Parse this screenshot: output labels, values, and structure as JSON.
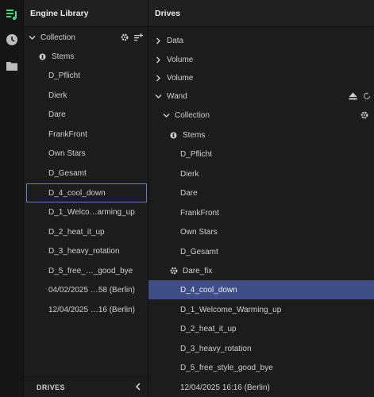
{
  "colors": {
    "accent_green": "#3ddc84",
    "selection_blue": "#3f4d85",
    "outline_blue": "#6b7bbd"
  },
  "rail": {
    "icons": [
      "playlist-icon",
      "history-clock-icon",
      "folder-icon"
    ]
  },
  "left": {
    "title": "Engine Library",
    "collection_label": "Collection",
    "stems_label": "Stems",
    "items": [
      "D_Pflicht",
      "Dierk",
      "Dare",
      "FrankFront",
      "Own Stars",
      "D_Gesamt",
      "D_4_cool_down",
      "D_1_Welco…arming_up",
      "D_2_heat_it_up",
      "D_3_heavy_rotation",
      "D_5_free_…_good_bye",
      "04/02/2025 …58 (Berlin)",
      "12/04/2025 …16 (Berlin)"
    ],
    "footer_label": "DRIVES"
  },
  "right": {
    "title": "Drives",
    "drives": [
      "Data",
      "Volume",
      "Volume",
      "Wand"
    ],
    "collection_label": "Collection",
    "stems_label": "Stems",
    "items": [
      "D_Pflicht",
      "Dierk",
      "Dare",
      "FrankFront",
      "Own Stars",
      "D_Gesamt"
    ],
    "dare_fix_label": "Dare_fix",
    "items2": [
      "D_4_cool_down",
      "D_1_Welcome_Warming_up",
      "D_2_heat_it_up",
      "D_3_heavy_rotation",
      "D_5_free_style_good_bye",
      "12/04/2025 16:16 (Berlin)"
    ]
  }
}
